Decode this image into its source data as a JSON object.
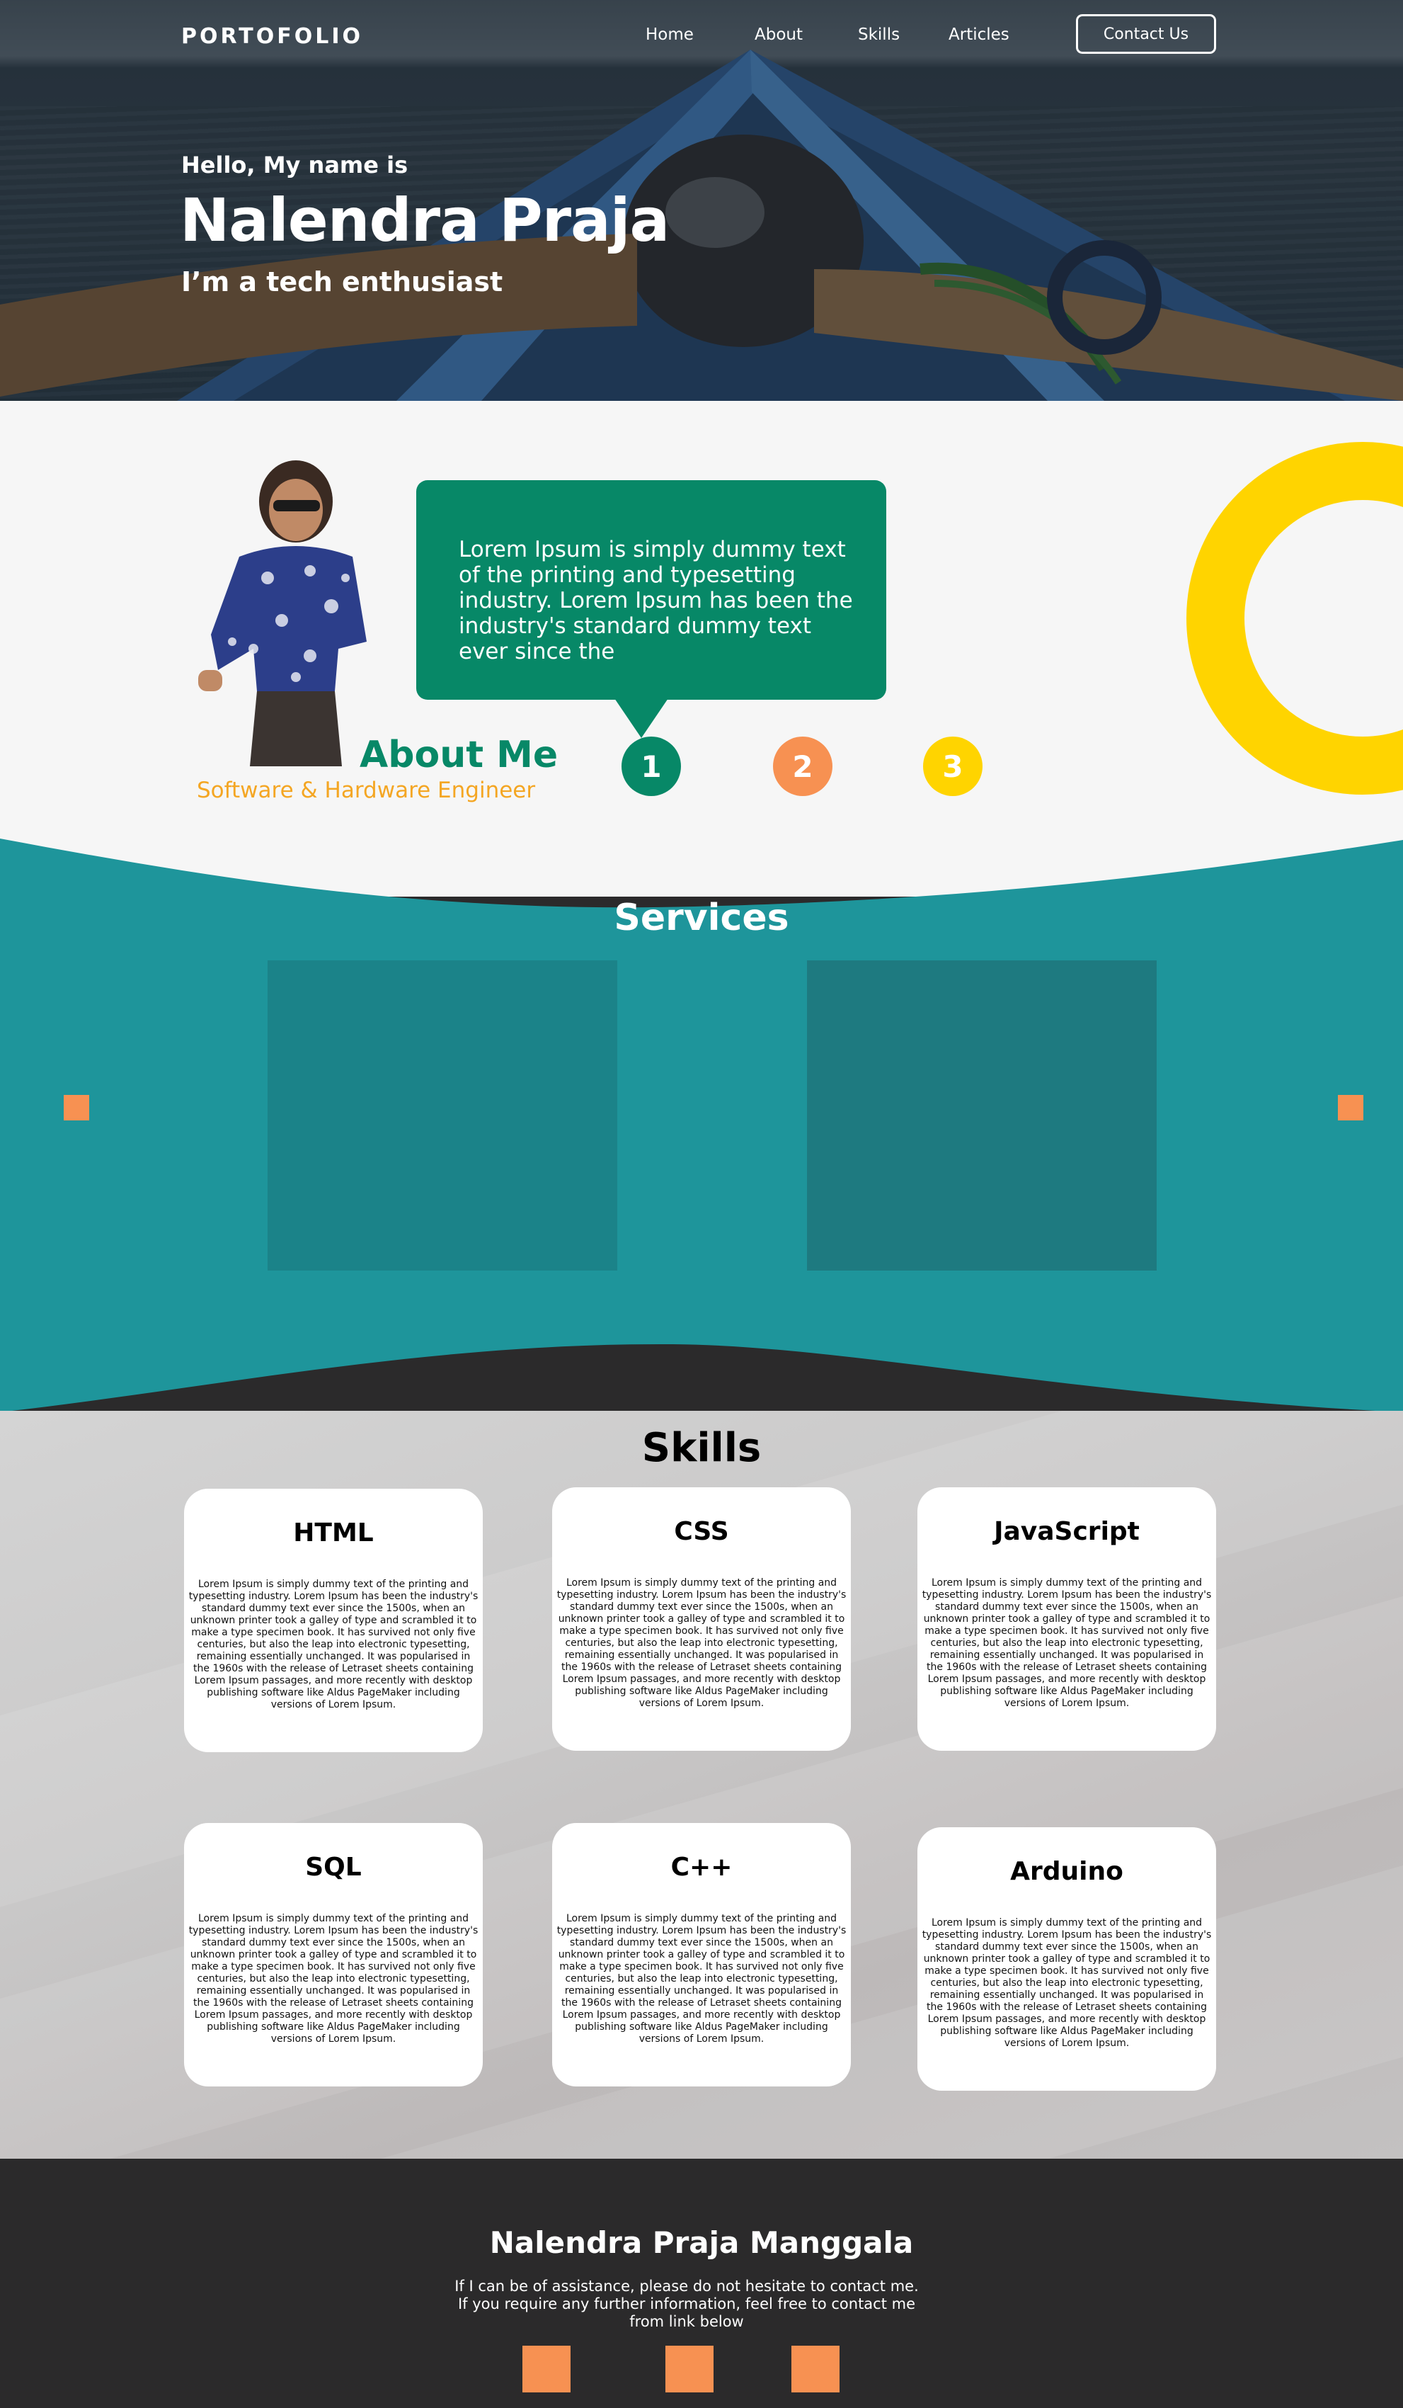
{
  "header": {
    "brand": "PORTOFOLIO",
    "nav": [
      {
        "label": "Home"
      },
      {
        "label": "About"
      },
      {
        "label": "Skills"
      },
      {
        "label": "Articles"
      }
    ],
    "contact_label": "Contact Us"
  },
  "hero": {
    "greeting": "Hello, My name is",
    "name": "Nalendra Praja",
    "tagline": "I’m a tech enthusiast"
  },
  "about": {
    "bubble_text": "Lorem Ipsum is simply dummy text of the printing and typesetting industry. Lorem Ipsum has been the industry's standard dummy text ever since the",
    "title": "About Me",
    "subtitle": "Software & Hardware Engineer",
    "slides": [
      {
        "label": "1",
        "color": "#078867"
      },
      {
        "label": "2",
        "color": "#f79152"
      },
      {
        "label": "3",
        "color": "#ffd400"
      }
    ]
  },
  "services": {
    "title": "Services"
  },
  "skills": {
    "title": "Skills",
    "items": [
      {
        "name": "HTML",
        "text": "Lorem Ipsum is simply dummy text of the printing and typesetting industry. Lorem Ipsum has been the industry's standard dummy text ever since the 1500s, when an unknown printer took a galley of type and scrambled it to make a type specimen book. It has survived not only five centuries, but also the leap into electronic typesetting, remaining essentially unchanged. It was popularised in the 1960s with the release of Letraset sheets containing Lorem Ipsum passages, and more recently with desktop publishing software like Aldus PageMaker including versions of Lorem Ipsum."
      },
      {
        "name": "CSS",
        "text": "Lorem Ipsum is simply dummy text of the printing and typesetting industry. Lorem Ipsum has been the industry's standard dummy text ever since the 1500s, when an unknown printer took a galley of type and scrambled it to make a type specimen book. It has survived not only five centuries, but also the leap into electronic typesetting, remaining essentially unchanged. It was popularised in the 1960s with the release of Letraset sheets containing Lorem Ipsum passages, and more recently with desktop publishing software like Aldus PageMaker including versions of Lorem Ipsum."
      },
      {
        "name": "JavaScript",
        "text": "Lorem Ipsum is simply dummy text of the printing and typesetting industry. Lorem Ipsum has been the industry's standard dummy text ever since the 1500s, when an unknown printer took a galley of type and scrambled it to make a type specimen book. It has survived not only five centuries, but also the leap into electronic typesetting, remaining essentially unchanged. It was popularised in the 1960s with the release of Letraset sheets containing Lorem Ipsum passages, and more recently with desktop publishing software like Aldus PageMaker including versions of Lorem Ipsum."
      },
      {
        "name": "SQL",
        "text": "Lorem Ipsum is simply dummy text of the printing and typesetting industry. Lorem Ipsum has been the industry's standard dummy text ever since the 1500s, when an unknown printer took a galley of type and scrambled it to make a type specimen book. It has survived not only five centuries, but also the leap into electronic typesetting, remaining essentially unchanged. It was popularised in the 1960s with the release of Letraset sheets containing Lorem Ipsum passages, and more recently with desktop publishing software like Aldus PageMaker including versions of Lorem Ipsum."
      },
      {
        "name": "C++",
        "text": "Lorem Ipsum is simply dummy text of the printing and typesetting industry. Lorem Ipsum has been the industry's standard dummy text ever since the 1500s, when an unknown printer took a galley of type and scrambled it to make a type specimen book. It has survived not only five centuries, but also the leap into electronic typesetting, remaining essentially unchanged. It was popularised in the 1960s with the release of Letraset sheets containing Lorem Ipsum passages, and more recently with desktop publishing software like Aldus PageMaker including versions of Lorem Ipsum."
      },
      {
        "name": "Arduino",
        "text": "Lorem Ipsum is simply dummy text of the printing and typesetting industry. Lorem Ipsum has been the industry's standard dummy text ever since the 1500s, when an unknown printer took a galley of type and scrambled it to make a type specimen book. It has survived not only five centuries, but also the leap into electronic typesetting, remaining essentially unchanged. It was popularised in the 1960s with the release of Letraset sheets containing Lorem Ipsum passages, and more recently with desktop publishing software like Aldus PageMaker including versions of Lorem Ipsum."
      }
    ]
  },
  "footer": {
    "name": "Nalendra Praja Manggala",
    "text": "If I can be of assistance, please do not hesitate to contact me. If you require any further information, feel free to contact me from link below"
  },
  "colors": {
    "green": "#078867",
    "teal": "#1e959b",
    "orange": "#f79152",
    "yellow": "#ffd400",
    "dark": "#2b2a2b"
  }
}
